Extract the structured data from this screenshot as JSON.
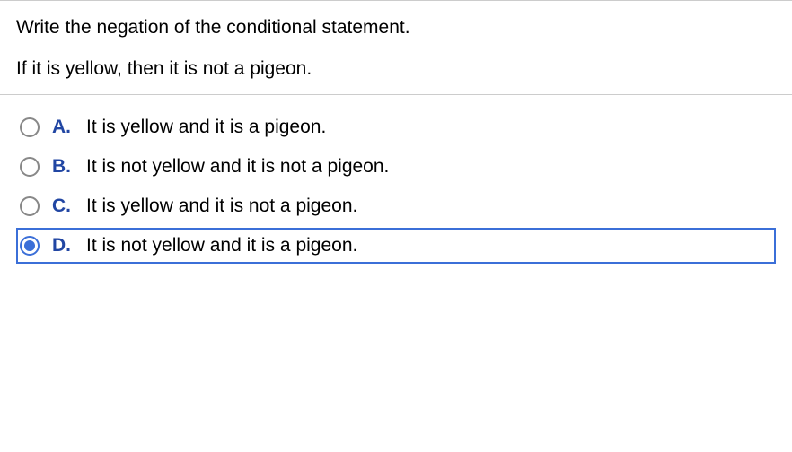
{
  "question": {
    "prompt": "Write the negation of the conditional statement.",
    "statement": "If it is yellow, then it is not a pigeon."
  },
  "options": [
    {
      "letter": "A.",
      "text": "It is yellow and it is a pigeon."
    },
    {
      "letter": "B.",
      "text": "It is not yellow and it is not a pigeon."
    },
    {
      "letter": "C.",
      "text": "It is yellow and it is not a pigeon."
    },
    {
      "letter": "D.",
      "text": "It is not yellow and it is a pigeon."
    }
  ],
  "selected_index": 3
}
